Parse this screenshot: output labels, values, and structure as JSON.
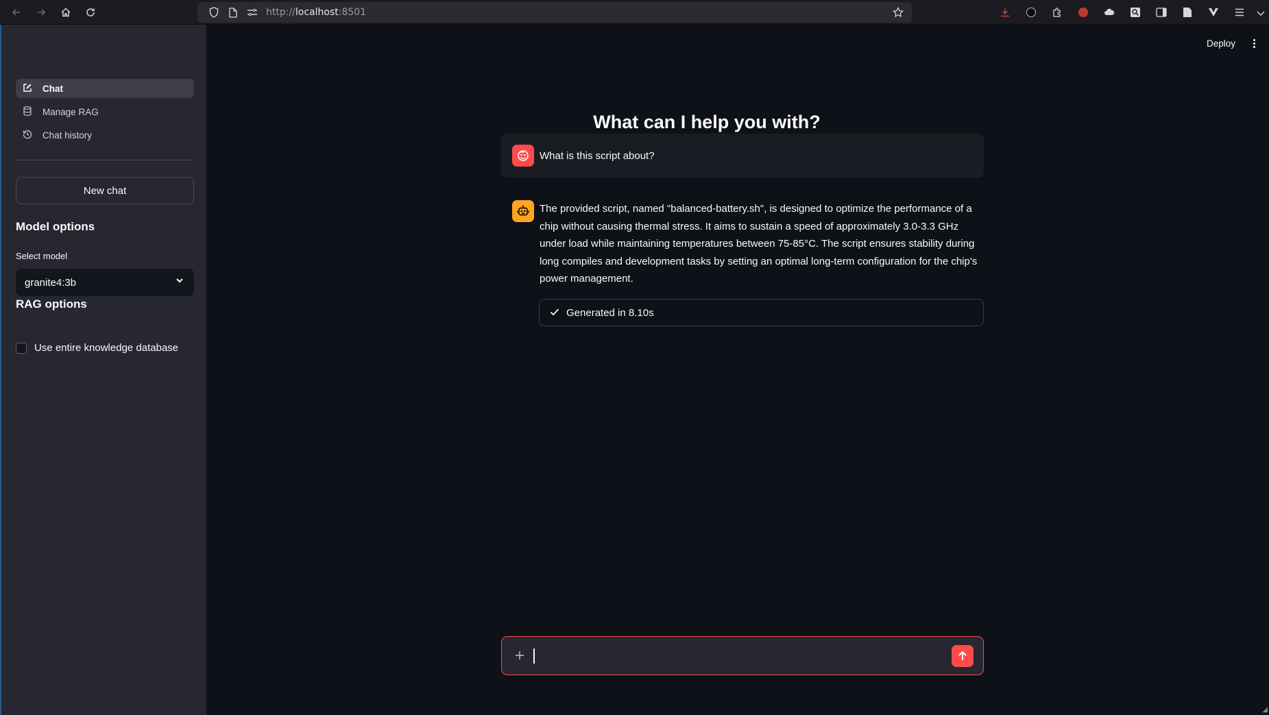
{
  "browser": {
    "url_scheme": "http://",
    "url_host": "localhost",
    "url_port": ":8501"
  },
  "sidebar": {
    "nav_items": [
      {
        "label": "Chat",
        "icon": "edit-icon",
        "active": true
      },
      {
        "label": "Manage RAG",
        "icon": "database-icon",
        "active": false
      },
      {
        "label": "Chat history",
        "icon": "history-icon",
        "active": false
      }
    ],
    "new_chat_label": "New chat",
    "model_options_heading": "Model options",
    "select_model_label": "Select model",
    "selected_model": "granite4:3b",
    "rag_options_heading": "RAG options",
    "use_entire_db_label": "Use entire knowledge database",
    "use_entire_db_checked": false
  },
  "header": {
    "deploy_label": "Deploy"
  },
  "main": {
    "title": "What can I help you with?",
    "messages": [
      {
        "role": "user",
        "text": "What is this script about?"
      },
      {
        "role": "assistant",
        "text": "The provided script, named \"balanced-battery.sh\", is designed to optimize the performance of a chip without causing thermal stress. It aims to sustain a speed of approximately 3.0-3.3 GHz under load while maintaining temperatures between 75-85°C. The script ensures stability during long compiles and development tasks by setting an optimal long-term configuration for the chip's power management."
      }
    ],
    "status_label": "Generated in 8.10s"
  },
  "chat_input": {
    "value": "",
    "placeholder": ""
  },
  "colors": {
    "accent": "#ff4b4b",
    "assistant_avatar": "#ffa421",
    "background": "#0e1117",
    "sidebar": "#262730"
  }
}
